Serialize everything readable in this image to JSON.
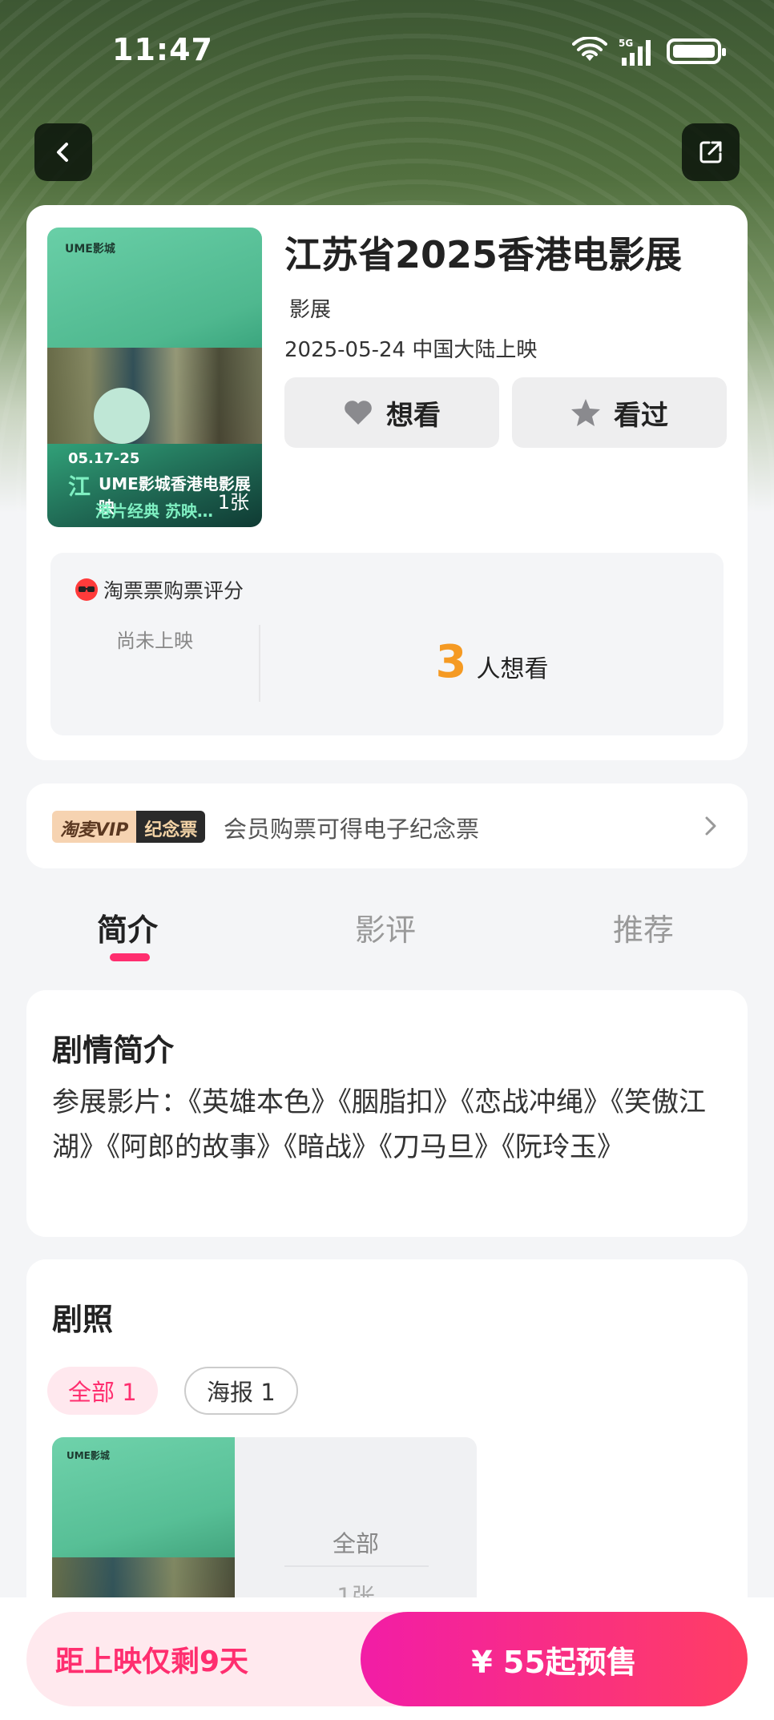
{
  "status_bar": {
    "time": "11:47",
    "network": "5G"
  },
  "movie": {
    "title": "江苏省2025香港电影展",
    "genre": "影展",
    "release": "2025-05-24 中国大陆上映",
    "poster_count": "1张",
    "poster": {
      "logo": "UME影城",
      "line1": "05.17-25",
      "line2": "江",
      "line3": "UME影城香港电影展映",
      "line4": "港片经典  苏映…"
    }
  },
  "actions": {
    "want_label": "想看",
    "seen_label": "看过"
  },
  "rating": {
    "title": "淘票票购票评分",
    "status": "尚未上映",
    "want_count": "3",
    "want_count_label": "人想看"
  },
  "vip": {
    "badge_left": "淘麦VIP",
    "badge_right": "纪念票",
    "text": "会员购票可得电子纪念票"
  },
  "tabs": [
    {
      "label": "简介",
      "active": true
    },
    {
      "label": "影评",
      "active": false
    },
    {
      "label": "推荐",
      "active": false
    }
  ],
  "synopsis": {
    "title": "剧情简介",
    "text": "参展影片：《英雄本色》《胭脂扣》《恋战冲绳》《笑傲江湖》《阿郎的故事》《暗战》《刀马旦》《阮玲玉》"
  },
  "stills": {
    "title": "剧照",
    "filters": [
      {
        "label": "全部 1",
        "active": true
      },
      {
        "label": "海报 1",
        "active": false
      }
    ],
    "tile_label": "全部",
    "tile_count": "1张",
    "tile_logo": "UME影城"
  },
  "bottom": {
    "countdown": "距上映仅剩9天",
    "presale": "¥ 55起预售"
  },
  "colors": {
    "accent": "#ff2e6f",
    "want_count": "#f59a23",
    "presale_gradient_start": "#f21da6",
    "presale_gradient_end": "#ff3e64"
  },
  "icons": {
    "back": "chevron-left-icon",
    "share": "share-icon",
    "want": "heart-icon",
    "seen": "star-icon",
    "rating": "taopiaopiao-logo-icon",
    "vip_arrow": "chevron-right-icon"
  }
}
